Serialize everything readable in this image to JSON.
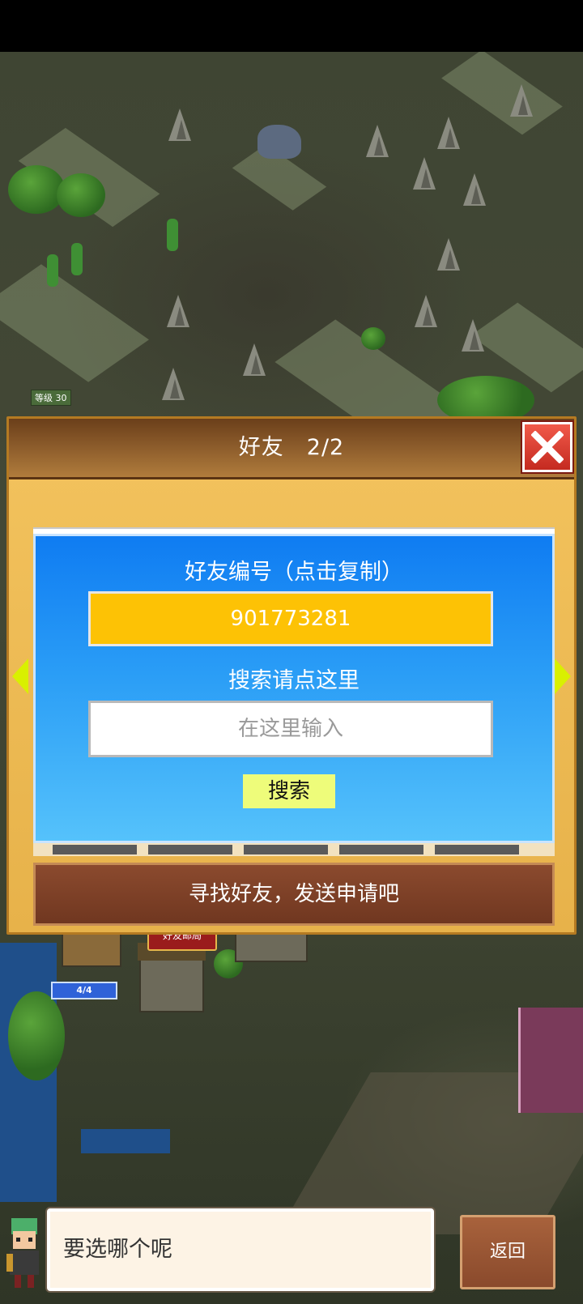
{
  "world": {
    "level_label": "等级 30",
    "building_label": "好友邮局",
    "capacity": "4/4"
  },
  "dialog": {
    "title": "好友　2/2",
    "friend_id_label": "好友编号（点击复制）",
    "friend_id_value": "901773281",
    "search_label": "搜索请点这里",
    "search_placeholder": "在这里输入",
    "search_button": "搜索",
    "find_friends_button": "寻找好友，发送申请吧"
  },
  "bottom": {
    "speech": "要选哪个呢",
    "back_button": "返回"
  },
  "colors": {
    "panel_blue": "#1f8cf4",
    "id_box_yellow": "#fdc205",
    "search_button_lime": "#eefc7a",
    "close_red": "#e0483a",
    "dialog_gold": "#f0c058"
  }
}
